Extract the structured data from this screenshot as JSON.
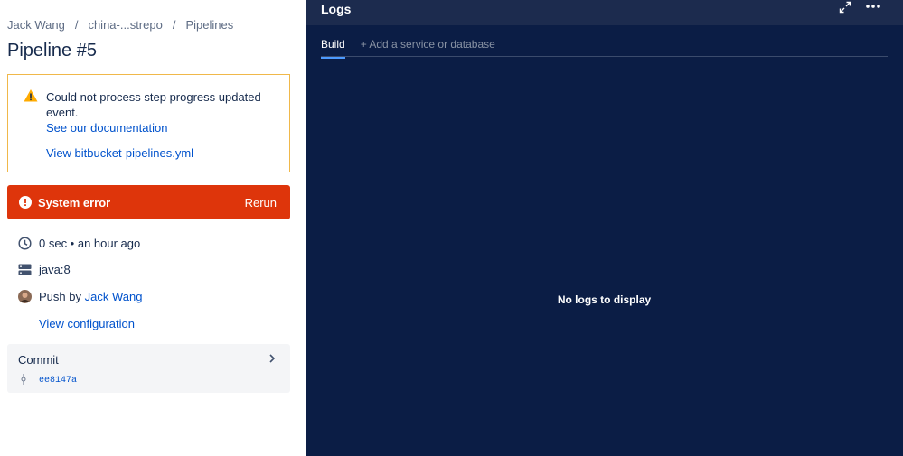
{
  "breadcrumb": {
    "items": [
      "Jack Wang",
      "china-...strepo",
      "Pipelines"
    ],
    "separator": "/"
  },
  "page": {
    "title": "Pipeline #5"
  },
  "warning": {
    "message": "Could not process step progress updated event.",
    "doc_link": "See our documentation",
    "yml_link": "View bitbucket-pipelines.yml",
    "icon": "warning-triangle-icon",
    "color": "#f0b84a"
  },
  "error": {
    "label": "System error",
    "rerun": "Rerun",
    "icon": "error-circle-icon",
    "color": "#de350b"
  },
  "meta": {
    "duration": "0 sec • an hour ago",
    "image": "java:8",
    "push_prefix": "Push by",
    "author": "Jack Wang",
    "view_config": "View configuration"
  },
  "commit": {
    "title": "Commit",
    "hash": "ee8147a"
  },
  "logs": {
    "title": "Logs",
    "tabs": [
      "Build",
      "+ Add a service or database"
    ],
    "empty": "No logs to display",
    "bg_color": "#0b1d45",
    "accent": "#4c9aff"
  }
}
